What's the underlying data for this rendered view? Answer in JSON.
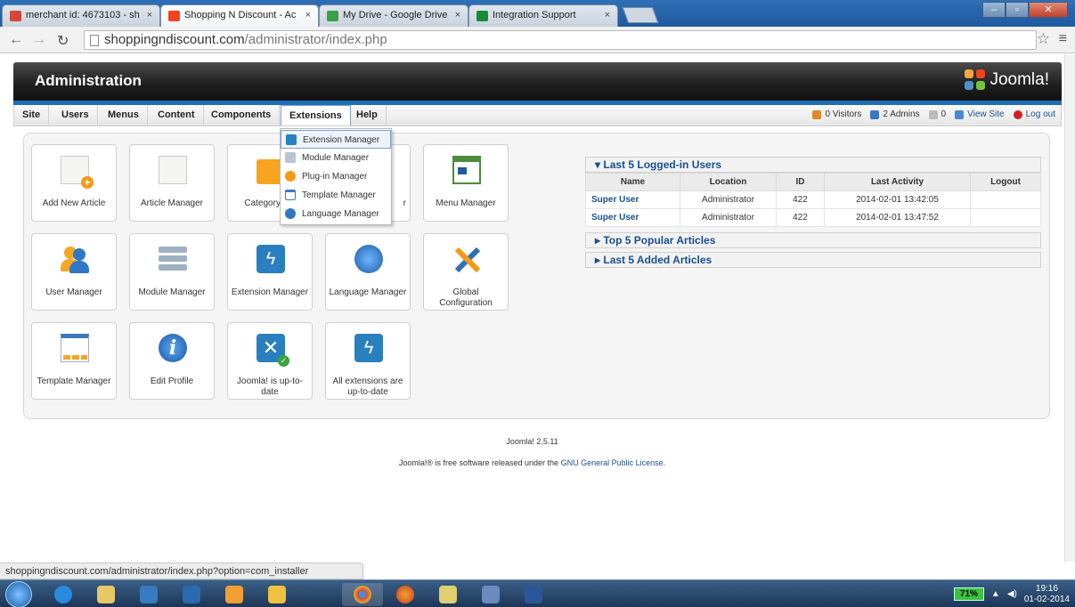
{
  "browser": {
    "tabs": [
      {
        "title": "merchant id: 4673103 - sh",
        "fav_color": "#d44638"
      },
      {
        "title": "Shopping N Discount - Ac",
        "fav_color": "#f44321",
        "active": true
      },
      {
        "title": "My Drive - Google Drive",
        "fav_color": "#3a9f4a"
      },
      {
        "title": "Integration Support",
        "fav_color": "#1a8a3a"
      }
    ],
    "url_host": "shoppingndiscount.com",
    "url_path": "/administrator/index.php",
    "status_url": "shoppingndiscount.com/administrator/index.php?option=com_installer"
  },
  "header": {
    "title": "Administration",
    "logo_text": "Joomla!"
  },
  "menu": {
    "items": [
      "Site",
      "Users",
      "Menus",
      "Content",
      "Components",
      "Extensions",
      "Help"
    ],
    "status": {
      "visitors": "0 Visitors",
      "admins": "2 Admins",
      "messages": "0",
      "view_site": "View Site",
      "logout": "Log out"
    }
  },
  "dropdown": {
    "items": [
      "Extension Manager",
      "Module Manager",
      "Plug-in Manager",
      "Template Manager",
      "Language Manager"
    ]
  },
  "quickicons": [
    {
      "label": "Add New Article",
      "icon": "article-add-icon"
    },
    {
      "label": "Article Manager",
      "icon": "article-icon"
    },
    {
      "label": "Category Ma",
      "icon": "folder-icon"
    },
    {
      "label": "r",
      "icon": "media-icon"
    },
    {
      "label": "Menu Manager",
      "icon": "menu-icon"
    },
    {
      "label": "User Manager",
      "icon": "user-icon"
    },
    {
      "label": "Module Manager",
      "icon": "module-icon"
    },
    {
      "label": "Extension Manager",
      "icon": "extension-icon"
    },
    {
      "label": "Language Manager",
      "icon": "globe-icon"
    },
    {
      "label": "Global Configuration",
      "icon": "tools-icon"
    },
    {
      "label": "Template Manager",
      "icon": "template-icon"
    },
    {
      "label": "Edit Profile",
      "icon": "info-icon"
    },
    {
      "label": "Joomla! is up-to-date",
      "icon": "joomla-update-icon"
    },
    {
      "label": "All extensions are up-to-date",
      "icon": "extension-update-icon"
    }
  ],
  "modules": {
    "logged_in": {
      "title": "▾ Last 5 Logged-in Users",
      "columns": [
        "Name",
        "Location",
        "ID",
        "Last Activity",
        "Logout"
      ],
      "rows": [
        [
          "Super User",
          "Administrator",
          "422",
          "2014-02-01 13:42:05",
          ""
        ],
        [
          "Super User",
          "Administrator",
          "422",
          "2014-02-01 13:47:52",
          ""
        ]
      ]
    },
    "popular": "▸ Top 5 Popular Articles",
    "added": "▸ Last 5 Added Articles"
  },
  "footer": {
    "version": "Joomla! 2.5.11",
    "license_prefix": "Joomla!® is free software released under the ",
    "license_link": "GNU General Public License",
    "license_suffix": "."
  },
  "taskbar": {
    "battery": "71%",
    "time": "19:16",
    "date": "01-02-2014"
  }
}
